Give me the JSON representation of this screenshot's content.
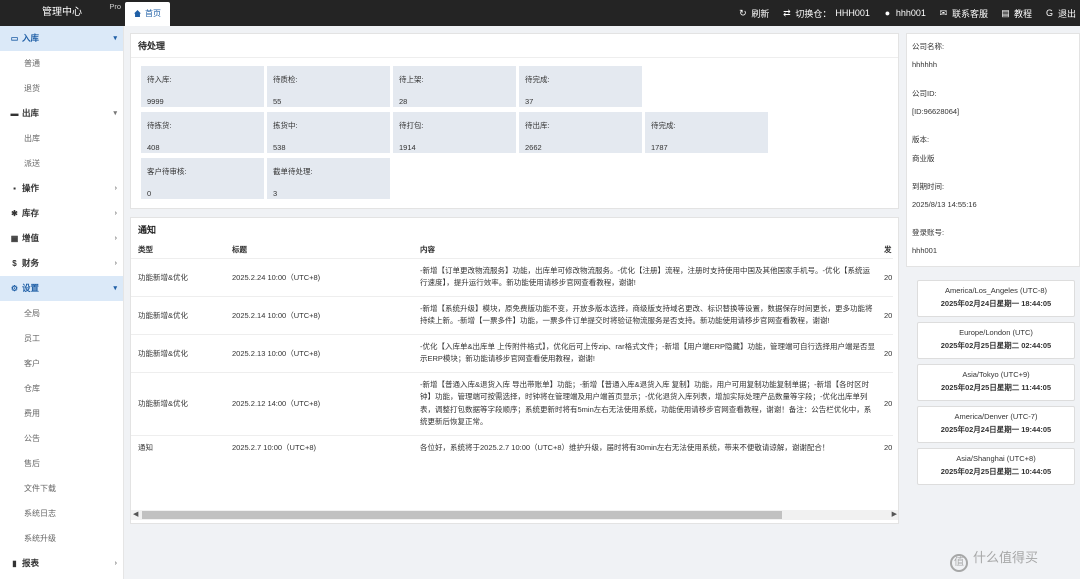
{
  "brand": {
    "title": "管理中心",
    "badge": "Pro"
  },
  "tabs": [
    {
      "label": "首页"
    }
  ],
  "topbar": {
    "refresh": "刷新",
    "switch_label": "切换仓：",
    "warehouse": "HHH001",
    "user": "hhh001",
    "support": "联系客服",
    "tutorial": "教程",
    "logout": "退出"
  },
  "sidebar": [
    {
      "label": "入库",
      "icon": "inbox-icon",
      "type": "parent",
      "active": true,
      "arrow": "▾"
    },
    {
      "label": "普通",
      "type": "child"
    },
    {
      "label": "退货",
      "type": "child"
    },
    {
      "label": "出库",
      "icon": "truck-icon",
      "type": "parent",
      "arrow": "▾"
    },
    {
      "label": "出库",
      "type": "child"
    },
    {
      "label": "派送",
      "type": "child"
    },
    {
      "label": "操作",
      "icon": "operation-icon",
      "type": "parent",
      "arrow": "›"
    },
    {
      "label": "库存",
      "icon": "stock-icon",
      "type": "parent",
      "arrow": "›"
    },
    {
      "label": "增值",
      "icon": "grid-icon",
      "type": "parent",
      "arrow": "›"
    },
    {
      "label": "财务",
      "icon": "dollar-icon",
      "type": "parent",
      "arrow": "›"
    },
    {
      "label": "设置",
      "icon": "gear-icon",
      "type": "parent",
      "active": true,
      "arrow": "▾"
    },
    {
      "label": "全局",
      "type": "child"
    },
    {
      "label": "员工",
      "type": "child"
    },
    {
      "label": "客户",
      "type": "child"
    },
    {
      "label": "仓库",
      "type": "child"
    },
    {
      "label": "费用",
      "type": "child"
    },
    {
      "label": "公告",
      "type": "child"
    },
    {
      "label": "售后",
      "type": "child"
    },
    {
      "label": "文件下载",
      "type": "child"
    },
    {
      "label": "系统日志",
      "type": "child"
    },
    {
      "label": "系统升级",
      "type": "child"
    },
    {
      "label": "报表",
      "icon": "chart-icon",
      "type": "parent",
      "arrow": "›"
    }
  ],
  "pending": {
    "title": "待处理",
    "stats": [
      {
        "label": "待入库:",
        "value": "9999"
      },
      {
        "label": "待质检:",
        "value": "55"
      },
      {
        "label": "待上架:",
        "value": "28"
      },
      {
        "label": "待完成:",
        "value": "37"
      },
      {
        "label": "待拣货:",
        "value": "408"
      },
      {
        "label": "拣货中:",
        "value": "538"
      },
      {
        "label": "待打包:",
        "value": "1914"
      },
      {
        "label": "待出库:",
        "value": "2662"
      },
      {
        "label": "待完成:",
        "value": "1787"
      },
      {
        "label": "客户待审核:",
        "value": "0"
      },
      {
        "label": "截单待处理:",
        "value": "3"
      }
    ]
  },
  "notice": {
    "title": "通知",
    "columns": [
      "类型",
      "标题",
      "内容",
      "发"
    ],
    "rows": [
      {
        "type": "功能新增&优化",
        "title": "2025.2.24 10:00（UTC+8)",
        "content": "-新增【订单更改物流服务】功能，出库单可修改物流服务。-优化【注册】流程，注册时支持使用中国及其他国家手机号。-优化【系统运行速度】，提升运行效率。新功能使用请移步官网查看教程，谢谢!",
        "extra": "20"
      },
      {
        "type": "功能新增&优化",
        "title": "2025.2.14 10:00（UTC+8)",
        "content": "-新增【系统升级】模块，原免费版功能不变，开放多版本选择，商级版支持域名更改、标识替换等设置，数据保存时间更长，更多功能将持续上新。-新增【一票多件】功能，一票多件订单提交时将验证物流服务是否支持。新功能使用请移步官网查看教程，谢谢!",
        "extra": "20"
      },
      {
        "type": "功能新增&优化",
        "title": "2025.2.13 10:00（UTC+8)",
        "content": "-优化【入库单&出库单 上传附件格式】，优化后可上传zip、rar格式文件；-新增【用户端ERP隐藏】功能，管理端可自行选择用户端是否显示ERP模块；新功能请移步官网查看使用教程，谢谢!",
        "extra": "20"
      },
      {
        "type": "功能新增&优化",
        "title": "2025.2.12 14:00（UTC+8)",
        "content": "-新增【普通入库&退货入库 导出带账单】功能；-新增【普通入库&退货入库 复制】功能，用户可用复制功能复制单据；-新增【各时区时钟】功能，管理端可按需选择，时钟将在管理端及用户端首页显示；-优化退货入库列表，增加实际处理产品数量等字段；-优化出库单列表，调整打包数据等字段顺序；系统更新时将有5min左右无法使用系统，功能使用请移步官网查看教程，谢谢！备注：公告栏优化中，系统更新后恢复正常。",
        "extra": "20"
      },
      {
        "type": "通知",
        "title": "2025.2.7 10:00（UTC+8)",
        "content": "各位好，系统将于2025.2.7 10:00（UTC+8）维护升级，届时将有30min左右无法使用系统，带来不便敬请谅解，谢谢配合！",
        "extra": "20"
      }
    ]
  },
  "company": {
    "name_label": "公司名称:",
    "name": "hhhhhh",
    "id_label": "公司ID:",
    "id": "[ID:96628064]",
    "version_label": "版本:",
    "version": "商业版",
    "expire_label": "到期时间:",
    "expire": "2025/8/13 14:55:16",
    "account_label": "登录账号:",
    "account": "hhh001"
  },
  "clocks": [
    {
      "tz": "America/Los_Angeles (UTC-8)",
      "time": "2025年02月24日星期一 18:44:05"
    },
    {
      "tz": "Europe/London (UTC)",
      "time": "2025年02月25日星期二 02:44:05"
    },
    {
      "tz": "Asia/Tokyo (UTC+9)",
      "time": "2025年02月25日星期二 11:44:05"
    },
    {
      "tz": "America/Denver (UTC-7)",
      "time": "2025年02月24日星期一 19:44:05"
    },
    {
      "tz": "Asia/Shanghai (UTC+8)",
      "time": "2025年02月25日星期二 10:44:05"
    }
  ],
  "watermark": {
    "text": "什么值得买",
    "mark": "值"
  },
  "colors": {
    "topbar": "#242424",
    "accent": "#1f5fa6",
    "active_bg": "#dbe9f8",
    "stat_bg": "#e4e9f0"
  }
}
